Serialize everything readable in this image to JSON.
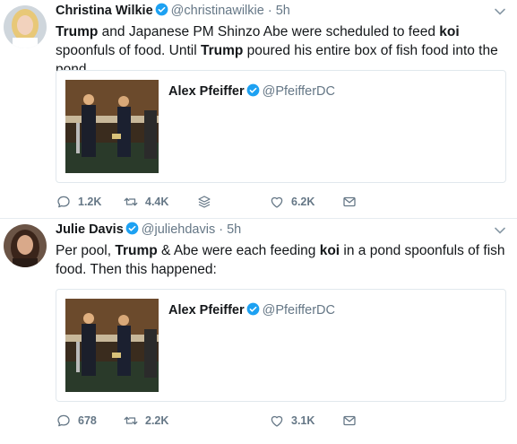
{
  "tweets": [
    {
      "name": "Christina Wilkie",
      "handle": "@christinawilkie",
      "separator": "·",
      "time": "5h",
      "text_parts": [
        {
          "t": "Trump",
          "b": true
        },
        {
          "t": " and Japanese PM Shinzo Abe were scheduled to feed ",
          "b": false
        },
        {
          "t": "koi",
          "b": true
        },
        {
          "t": " spoonfuls of food. Until ",
          "b": false
        },
        {
          "t": "Trump",
          "b": true
        },
        {
          "t": " poured his entire box of fish food into the pond.",
          "b": false
        }
      ],
      "quoted": {
        "name": "Alex Pfeiffer",
        "handle": "@PfeifferDC"
      },
      "replies": "1.2K",
      "retweets": "4.4K",
      "likes": "6.2K"
    },
    {
      "name": "Julie Davis",
      "handle": "@juliehdavis",
      "separator": "·",
      "time": "5h",
      "text_parts": [
        {
          "t": "Per pool, ",
          "b": false
        },
        {
          "t": "Trump",
          "b": true
        },
        {
          "t": " & Abe were each feeding ",
          "b": false
        },
        {
          "t": "koi",
          "b": true
        },
        {
          "t": " in a pond spoonfuls of fish food. Then this happened:",
          "b": false
        }
      ],
      "quoted": {
        "name": "Alex Pfeiffer",
        "handle": "@PfeifferDC"
      },
      "replies": "678",
      "retweets": "2.2K",
      "likes": "3.1K"
    }
  ],
  "colors": {
    "verified": "#1da1f2",
    "muted": "#657786",
    "border": "#e1e8ed"
  }
}
